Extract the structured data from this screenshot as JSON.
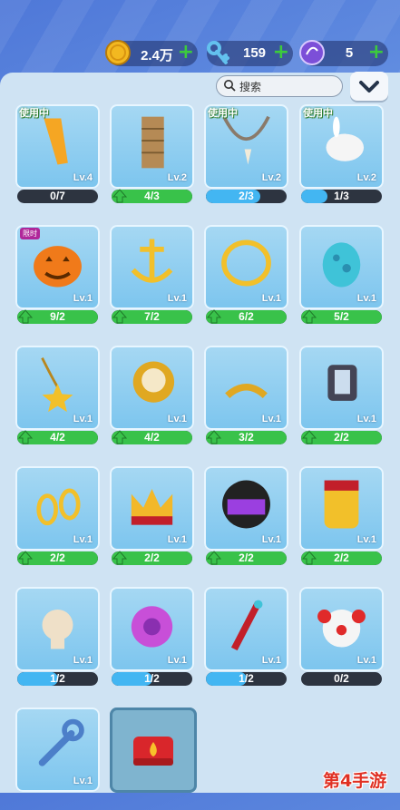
{
  "currency": {
    "coins": {
      "value": "2.4万",
      "icon": "gold-coin-icon"
    },
    "keys": {
      "value": "159",
      "icon": "key-icon"
    },
    "gems": {
      "value": "5",
      "icon": "purple-orb-icon"
    }
  },
  "toolbar": {
    "search_placeholder": "搜索"
  },
  "colors": {
    "progress_blue": "#43b6f2",
    "progress_green": "#39c24a",
    "panel": "#cfe3f3",
    "accent_green": "#3ccb3c"
  },
  "items": [
    {
      "name": "orange-sash",
      "tag": "使用中",
      "level": "Lv.4",
      "count": "0/7",
      "progress": 0,
      "upgradable": false
    },
    {
      "name": "tower-building",
      "tag": "",
      "level": "Lv.2",
      "count": "4/3",
      "progress": 1,
      "upgradable": true
    },
    {
      "name": "fang-necklace",
      "tag": "使用中",
      "level": "Lv.2",
      "count": "2/3",
      "progress": 0.67,
      "upgradable": false
    },
    {
      "name": "white-rabbit",
      "tag": "使用中",
      "level": "Lv.2",
      "count": "1/3",
      "progress": 0.33,
      "upgradable": false
    },
    {
      "name": "jack-o-lantern",
      "tag": "",
      "badge": "限时",
      "level": "Lv.1",
      "count": "9/2",
      "progress": 1,
      "upgradable": true
    },
    {
      "name": "golden-anchor",
      "tag": "",
      "level": "Lv.1",
      "count": "7/2",
      "progress": 1,
      "upgradable": true
    },
    {
      "name": "golden-ring",
      "tag": "",
      "level": "Lv.1",
      "count": "6/2",
      "progress": 1,
      "upgradable": true
    },
    {
      "name": "spotted-egg",
      "tag": "",
      "level": "Lv.1",
      "count": "5/2",
      "progress": 1,
      "upgradable": true
    },
    {
      "name": "star-necklace",
      "tag": "",
      "level": "Lv.1",
      "count": "4/2",
      "progress": 1,
      "upgradable": true
    },
    {
      "name": "clock-bell",
      "tag": "",
      "level": "Lv.1",
      "count": "4/2",
      "progress": 1,
      "upgradable": true
    },
    {
      "name": "golden-mustache",
      "tag": "",
      "level": "Lv.1",
      "count": "3/2",
      "progress": 1,
      "upgradable": true
    },
    {
      "name": "smart-watch",
      "tag": "",
      "level": "Lv.1",
      "count": "2/2",
      "progress": 1,
      "upgradable": true
    },
    {
      "name": "golden-earrings",
      "tag": "",
      "level": "Lv.1",
      "count": "2/2",
      "progress": 1,
      "upgradable": true
    },
    {
      "name": "royal-crown",
      "tag": "",
      "level": "Lv.1",
      "count": "2/2",
      "progress": 1,
      "upgradable": true
    },
    {
      "name": "racing-helmet",
      "tag": "",
      "level": "Lv.1",
      "count": "2/2",
      "progress": 1,
      "upgradable": true
    },
    {
      "name": "gold-mask-can",
      "tag": "",
      "level": "Lv.1",
      "count": "2/2",
      "progress": 1,
      "upgradable": true
    },
    {
      "name": "tan-head",
      "tag": "",
      "level": "Lv.1",
      "count": "1/2",
      "progress": 0.5,
      "upgradable": false
    },
    {
      "name": "purple-flower",
      "tag": "",
      "level": "Lv.1",
      "count": "1/2",
      "progress": 0.5,
      "upgradable": false
    },
    {
      "name": "red-staff",
      "tag": "",
      "level": "Lv.1",
      "count": "1/2",
      "progress": 0.5,
      "upgradable": false
    },
    {
      "name": "clown-face",
      "tag": "",
      "level": "Lv.1",
      "count": "0/2",
      "progress": 0,
      "upgradable": false
    },
    {
      "name": "wrench-key",
      "tag": "",
      "level": "Lv.1",
      "count": "",
      "progress": null,
      "upgradable": false
    },
    {
      "name": "fire-hat",
      "tag": "",
      "level": "",
      "count": "",
      "progress": null,
      "upgradable": false
    }
  ],
  "watermark": "第4手游"
}
